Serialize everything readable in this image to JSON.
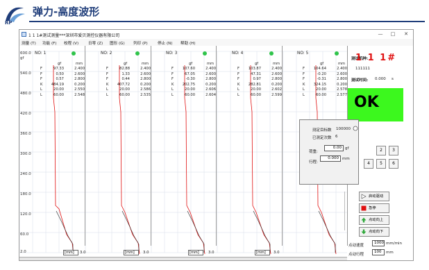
{
  "slide": {
    "title": "弹力-高度波形"
  },
  "window": {
    "title": "1 1 1#测试测量***深圳市爱贝测控仪器有限公司",
    "controls": [
      "—",
      "□",
      "✕"
    ]
  },
  "menu": [
    "测量 (T)",
    "功能 (F)",
    "校程 (V)",
    "日零 (Z)",
    "图形 (G)",
    "列印 (P)",
    "停止 (N)",
    "帮助 (H)"
  ],
  "y_axis": {
    "unit": "gf",
    "ticks": [
      "600.0",
      "540.0",
      "480.0",
      "420.0",
      "360.0",
      "300.0",
      "240.0",
      "180.0",
      "120.0",
      "60.0",
      "2.0"
    ]
  },
  "panels": [
    {
      "no": "NO: 1",
      "unit_force": "gf",
      "unit_len": "mm",
      "rows": [
        {
          "k": "F",
          "gf": "97.33",
          "mm": "2.400"
        },
        {
          "k": "F",
          "gf": "0.50",
          "mm": "2.600"
        },
        {
          "k": "F",
          "gf": "0.57",
          "mm": "2.800"
        },
        {
          "k": "K",
          "gf": "484.19",
          "mm": "0.200"
        },
        {
          "k": "L",
          "gf": "20.00",
          "mm": "2.550"
        },
        {
          "k": "L",
          "gf": "60.00",
          "mm": "2.548"
        }
      ],
      "axis_mm": "[mm]",
      "axis_max": "3.0"
    },
    {
      "no": "NO: 2",
      "unit_force": "gf",
      "unit_len": "mm",
      "rows": [
        {
          "k": "F",
          "gf": "82.88",
          "mm": "2.400"
        },
        {
          "k": "F",
          "gf": "1.33",
          "mm": "2.600"
        },
        {
          "k": "F",
          "gf": "0.44",
          "mm": "2.800"
        },
        {
          "k": "K",
          "gf": "407.72",
          "mm": "0.200"
        },
        {
          "k": "L",
          "gf": "20.00",
          "mm": "2.586"
        },
        {
          "k": "L",
          "gf": "60.00",
          "mm": "2.535"
        }
      ],
      "axis_mm": "[mm]",
      "axis_max": "3.0"
    },
    {
      "no": "NO: 3",
      "unit_force": "gf",
      "unit_len": "mm",
      "rows": [
        {
          "k": "F",
          "gf": "107.60",
          "mm": "2.400"
        },
        {
          "k": "F",
          "gf": "67.05",
          "mm": "2.600"
        },
        {
          "k": "F",
          "gf": "-0.30",
          "mm": "2.800"
        },
        {
          "k": "K",
          "gf": "202.75",
          "mm": "0.200"
        },
        {
          "k": "L",
          "gf": "20.00",
          "mm": "2.606"
        },
        {
          "k": "L",
          "gf": "60.00",
          "mm": "2.604"
        }
      ],
      "axis_mm": "[mm]",
      "axis_max": "3.0"
    },
    {
      "no": "NO: 4",
      "unit_force": "gf",
      "unit_len": "mm",
      "rows": [
        {
          "k": "F",
          "gf": "103.87",
          "mm": "2.400"
        },
        {
          "k": "F",
          "gf": "47.31",
          "mm": "2.600"
        },
        {
          "k": "F",
          "gf": "0.97",
          "mm": "2.800"
        },
        {
          "k": "K",
          "gf": "282.81",
          "mm": "0.200"
        },
        {
          "k": "L",
          "gf": "20.00",
          "mm": "2.602"
        },
        {
          "k": "L",
          "gf": "60.00",
          "mm": "2.599"
        }
      ],
      "axis_mm": "[mm]",
      "axis_max": "3.0"
    },
    {
      "no": "NO: 5",
      "unit_force": "gf",
      "unit_len": "mm",
      "rows": [
        {
          "k": "F",
          "gf": "104.64",
          "mm": "2.400"
        },
        {
          "k": "F",
          "gf": "-0.20",
          "mm": "2.600"
        },
        {
          "k": "F",
          "gf": "-0.31",
          "mm": "2.800"
        },
        {
          "k": "K",
          "gf": "324.15",
          "mm": "0.200"
        },
        {
          "k": "L",
          "gf": "20.00",
          "mm": "2.578"
        },
        {
          "k": "L",
          "gf": "60.00",
          "mm": "2.577"
        }
      ],
      "axis_mm": "",
      "axis_max": ""
    }
  ],
  "right": {
    "machine_label": "测试机种:",
    "machine_no": "1 1 1#",
    "code": "111111",
    "time_label": "测试时间:",
    "time_value": "0.000",
    "time_unit": "s",
    "result": "OK",
    "result_color": "#3cf81e"
  },
  "popup": {
    "target_label": "测定目标数",
    "target_value": "100000",
    "done_label": "已测定次数",
    "done_value": "6",
    "load_label": "荷重:",
    "load_value": "0.00",
    "load_unit": "gf",
    "travel_label": "行程:",
    "travel_value": "0.000",
    "travel_unit": "mm"
  },
  "num_buttons": [
    "2",
    "3",
    "4",
    "5",
    "6"
  ],
  "commands": {
    "start": "启动驱动",
    "stop": "急停",
    "up": "点动向上",
    "down": "点动向下"
  },
  "jog": {
    "speed_label": "点动速度",
    "speed_value": "1000",
    "speed_unit": "mm/min",
    "travel_label": "点动行程",
    "travel_value": "100",
    "travel_unit": "mm"
  },
  "colors": {
    "brand": "#1f3d7a",
    "curve": "#e01010",
    "ok": "#3cf81e",
    "stop": "#e01010",
    "arrow": "#2fa83a"
  }
}
